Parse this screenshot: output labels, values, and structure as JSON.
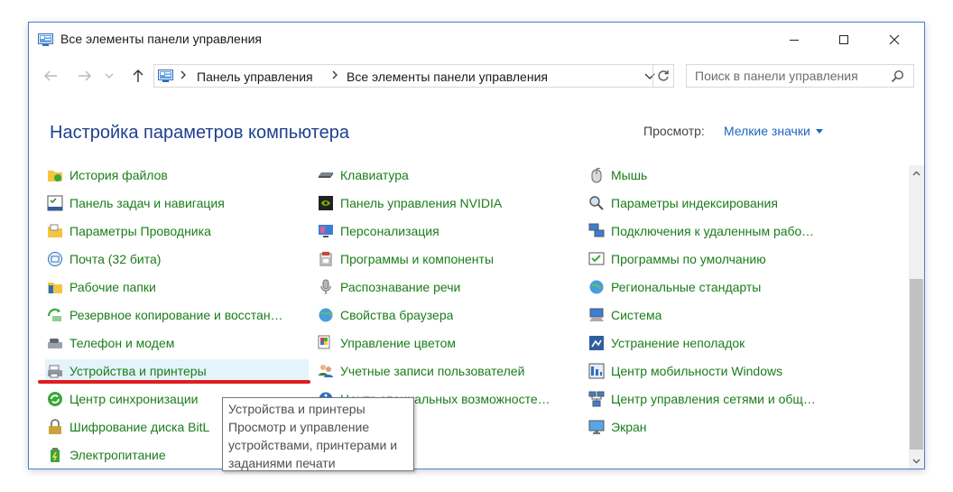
{
  "window": {
    "title": "Все элементы панели управления"
  },
  "nav": {
    "breadcrumbs": [
      "Панель управления",
      "Все элементы панели управления"
    ]
  },
  "search": {
    "placeholder": "Поиск в панели управления"
  },
  "header": {
    "title": "Настройка параметров компьютера",
    "view_label": "Просмотр:",
    "view_value": "Мелкие значки"
  },
  "items": {
    "col1": [
      {
        "label": "История файлов",
        "icon": "folder-clock-icon"
      },
      {
        "label": "Панель задач и навигация",
        "icon": "taskbar-icon"
      },
      {
        "label": "Параметры Проводника",
        "icon": "folder-options-icon"
      },
      {
        "label": "Почта (32 бита)",
        "icon": "mail-icon"
      },
      {
        "label": "Рабочие папки",
        "icon": "work-folders-icon"
      },
      {
        "label": "Резервное копирование и восстан…",
        "icon": "backup-icon"
      },
      {
        "label": "Телефон и модем",
        "icon": "phone-modem-icon"
      },
      {
        "label": "Устройства и принтеры",
        "icon": "printer-icon",
        "selected": true
      },
      {
        "label": "Центр синхронизации",
        "icon": "sync-icon"
      },
      {
        "label": "Шифрование диска BitL",
        "icon": "bitlocker-icon"
      },
      {
        "label": "Электропитание",
        "icon": "power-icon"
      }
    ],
    "col2": [
      {
        "label": "Клавиатура",
        "icon": "keyboard-icon"
      },
      {
        "label": "Панель управления NVIDIA",
        "icon": "nvidia-icon"
      },
      {
        "label": "Персонализация",
        "icon": "personalization-icon"
      },
      {
        "label": "Программы и компоненты",
        "icon": "programs-icon"
      },
      {
        "label": "Распознавание речи",
        "icon": "microphone-icon"
      },
      {
        "label": "Свойства браузера",
        "icon": "internet-options-icon"
      },
      {
        "label": "Управление цветом",
        "icon": "color-management-icon"
      },
      {
        "label": "Учетные записи пользователей",
        "icon": "user-accounts-icon"
      },
      {
        "label": "Центр специальных возможносте…",
        "icon": "accessibility-icon"
      }
    ],
    "col3": [
      {
        "label": "Мышь",
        "icon": "mouse-icon"
      },
      {
        "label": "Параметры индексирования",
        "icon": "indexing-icon"
      },
      {
        "label": "Подключения к удаленным рабоч…",
        "icon": "remote-desktop-icon"
      },
      {
        "label": "Программы по умолчанию",
        "icon": "default-programs-icon"
      },
      {
        "label": "Региональные стандарты",
        "icon": "region-icon"
      },
      {
        "label": "Система",
        "icon": "system-icon"
      },
      {
        "label": "Устранение неполадок",
        "icon": "troubleshooting-icon"
      },
      {
        "label": "Центр мобильности Windows",
        "icon": "mobility-center-icon"
      },
      {
        "label": "Центр управления сетями и общи…",
        "icon": "network-center-icon"
      },
      {
        "label": "Экран",
        "icon": "display-icon"
      }
    ]
  },
  "tooltip": {
    "lines": [
      "Устройства и принтеры",
      "Просмотр и управление",
      "устройствами, принтерами и",
      "заданиями печати"
    ]
  }
}
